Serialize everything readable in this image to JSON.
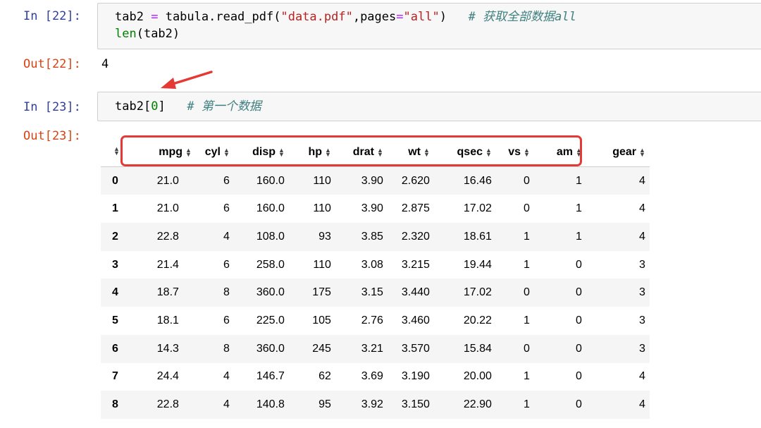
{
  "cells": [
    {
      "in_prompt": "In [22]:",
      "code_line1": {
        "var": "tab2",
        "op": "=",
        "call": "tabula.read_pdf(",
        "arg_str": "\"data.pdf\"",
        "sep": ",pages",
        "eq": "=",
        "arg2": "\"all\"",
        "close": ")",
        "comment": "# 获取全部数据all"
      },
      "code_line2": {
        "fn": "len",
        "args": "(tab2)"
      },
      "out_prompt": "Out[22]:",
      "output": "4"
    },
    {
      "in_prompt": "In [23]:",
      "code_line1": {
        "pre": "tab2[",
        "idx": "0",
        "post": "]",
        "comment": "# 第一个数据"
      },
      "out_prompt": "Out[23]:"
    }
  ],
  "dataframe": {
    "index_sort_icon": "sort-icon",
    "columns": [
      "mpg",
      "cyl",
      "disp",
      "hp",
      "drat",
      "wt",
      "qsec",
      "vs",
      "am",
      "gear"
    ],
    "rows": [
      {
        "index": "0",
        "values": [
          "21.0",
          "6",
          "160.0",
          "110",
          "3.90",
          "2.620",
          "16.46",
          "0",
          "1",
          "4"
        ]
      },
      {
        "index": "1",
        "values": [
          "21.0",
          "6",
          "160.0",
          "110",
          "3.90",
          "2.875",
          "17.02",
          "0",
          "1",
          "4"
        ]
      },
      {
        "index": "2",
        "values": [
          "22.8",
          "4",
          "108.0",
          "93",
          "3.85",
          "2.320",
          "18.61",
          "1",
          "1",
          "4"
        ]
      },
      {
        "index": "3",
        "values": [
          "21.4",
          "6",
          "258.0",
          "110",
          "3.08",
          "3.215",
          "19.44",
          "1",
          "0",
          "3"
        ]
      },
      {
        "index": "4",
        "values": [
          "18.7",
          "8",
          "360.0",
          "175",
          "3.15",
          "3.440",
          "17.02",
          "0",
          "0",
          "3"
        ]
      },
      {
        "index": "5",
        "values": [
          "18.1",
          "6",
          "225.0",
          "105",
          "2.76",
          "3.460",
          "20.22",
          "1",
          "0",
          "3"
        ]
      },
      {
        "index": "6",
        "values": [
          "14.3",
          "8",
          "360.0",
          "245",
          "3.21",
          "3.570",
          "15.84",
          "0",
          "0",
          "3"
        ]
      },
      {
        "index": "7",
        "values": [
          "24.4",
          "4",
          "146.7",
          "62",
          "3.69",
          "3.190",
          "20.00",
          "1",
          "0",
          "4"
        ]
      },
      {
        "index": "8",
        "values": [
          "22.8",
          "4",
          "140.8",
          "95",
          "3.92",
          "3.150",
          "22.90",
          "1",
          "0",
          "4"
        ]
      }
    ]
  },
  "annotations": {
    "arrow_color": "#e53935",
    "highlight_color": "#e53935"
  }
}
